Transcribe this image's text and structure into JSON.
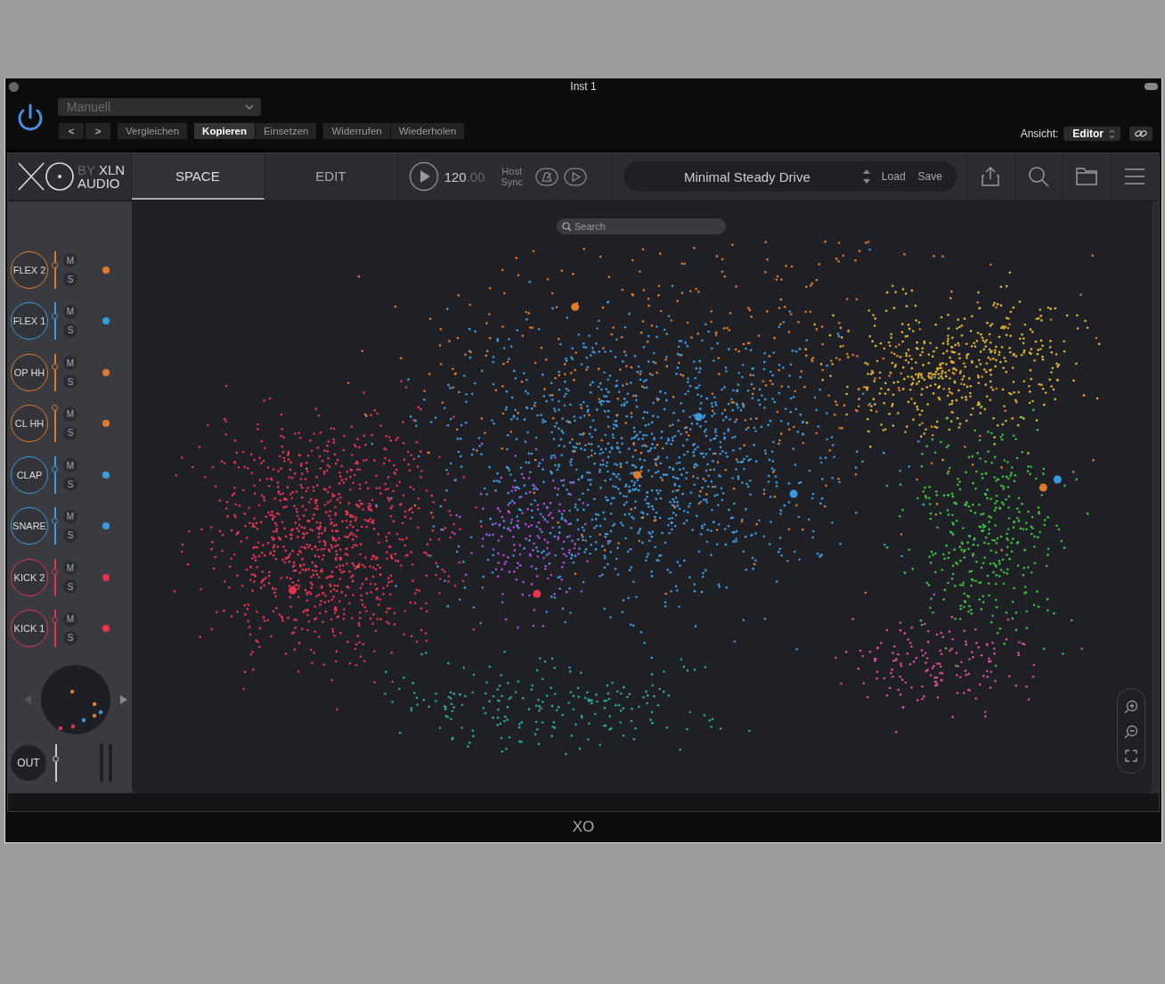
{
  "window": {
    "title": "Inst 1",
    "footer": "XO"
  },
  "host": {
    "preset": "Manuell",
    "prev": "<",
    "next": ">",
    "buttons": [
      {
        "label": "Vergleichen",
        "active": false
      },
      {
        "label": "Kopieren",
        "active": true
      },
      {
        "label": "Einsetzen",
        "active": false
      },
      {
        "label": "Widerrufen",
        "active": false
      },
      {
        "label": "Wiederholen",
        "active": false
      }
    ],
    "view_label": "Ansicht:",
    "view": "Editor"
  },
  "logo": {
    "by": "BY",
    "brand": "XLN",
    "sub": "AUDIO"
  },
  "tabs": [
    {
      "label": "SPACE",
      "selected": true
    },
    {
      "label": "EDIT",
      "selected": false
    }
  ],
  "transport": {
    "tempo": "120.00",
    "host_sync": "Host Sync"
  },
  "preset_bar": {
    "name": "Minimal Steady Drive",
    "load": "Load",
    "save": "Save"
  },
  "search": {
    "placeholder": "Search"
  },
  "channels": [
    {
      "name": "FLEX 2",
      "color": "#e07a2a",
      "level": 0.64,
      "mute": "M",
      "solo": "S"
    },
    {
      "name": "FLEX 1",
      "color": "#3a9be0",
      "level": 0.65,
      "mute": "M",
      "solo": "S"
    },
    {
      "name": "OP HH",
      "color": "#e07a2a",
      "level": 0.65,
      "mute": "M",
      "solo": "S"
    },
    {
      "name": "CL HH",
      "color": "#e07a2a",
      "level": 0.93,
      "mute": "M",
      "solo": "S"
    },
    {
      "name": "CLAP",
      "color": "#3a9be0",
      "level": 0.65,
      "mute": "M",
      "solo": "S"
    },
    {
      "name": "SNARE",
      "color": "#3a9be0",
      "level": 0.65,
      "mute": "M",
      "solo": "S"
    },
    {
      "name": "KICK 2",
      "color": "#e8334f",
      "level": 0.65,
      "mute": "M",
      "solo": "S"
    },
    {
      "name": "KICK 1",
      "color": "#e8334f",
      "level": 0.75,
      "mute": "M",
      "solo": "S"
    }
  ],
  "output": {
    "label": "OUT",
    "level": 0.63
  }
}
